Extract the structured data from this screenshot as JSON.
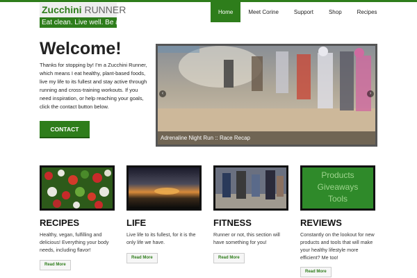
{
  "logo": {
    "name_part1": "Zucchini",
    "name_part2": "RUNNER",
    "tagline": "Eat clean. Live well. Be active."
  },
  "nav": {
    "items": [
      {
        "label": "Home"
      },
      {
        "label": "Meet Corine"
      },
      {
        "label": "Support"
      },
      {
        "label": "Shop"
      },
      {
        "label": "Recipes"
      }
    ]
  },
  "welcome": {
    "title": "Welcome!",
    "text": "Thanks for stopping by! I'm a Zucchini Runner, which means I eat healthy, plant-based foods, live my life to its fullest and stay active through running and cross-training workouts. If you need inspiration, or help reaching your goals, click the contact button below.",
    "button": "CONTACT"
  },
  "slider": {
    "caption": "Adrenaline Night Run :: Race Recap",
    "prev": "‹",
    "next": "›"
  },
  "sections": [
    {
      "title": "RECIPES",
      "text": "Healthy, vegan, fulfilling and delicious! Everything your body needs, including flavor!",
      "button": "Read More"
    },
    {
      "title": "LIFE",
      "text": "Live life to its fullest, for it is the only life we have.",
      "button": "Read More"
    },
    {
      "title": "FITNESS",
      "text": "Runner or not, this section will have something for you!",
      "button": "Read More"
    },
    {
      "title": "REVIEWS",
      "text": "Constantly on the lookout for new products and tools that will make your healthy lifestyle more efficient? Me too!",
      "button": "Read More"
    }
  ],
  "reviews_image": {
    "line1": "Products",
    "line2": "Giveaways",
    "line3": "Tools"
  },
  "colors": {
    "brand_green": "#2e7d1b",
    "light_green": "#9dd48d"
  }
}
